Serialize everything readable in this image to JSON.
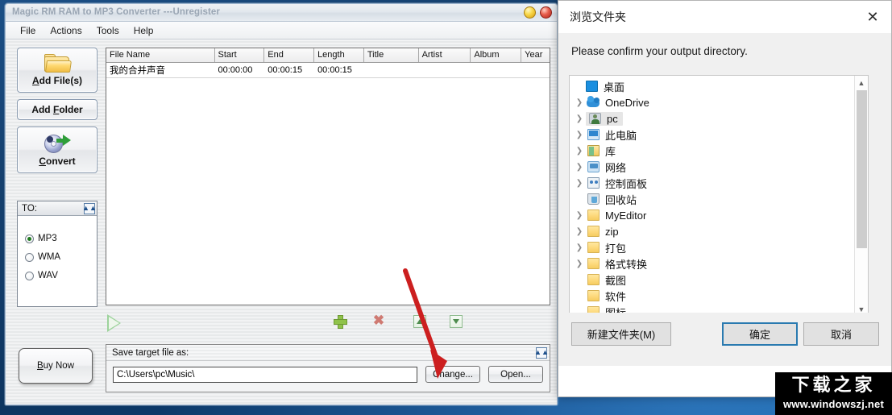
{
  "app": {
    "title": "Magic RM RAM to MP3 Converter ---Unregister",
    "window_buttons": [
      {
        "name": "minimize-button",
        "icon": "circle-yellow"
      },
      {
        "name": "close-button",
        "icon": "circle-red"
      }
    ],
    "menu": [
      "File",
      "Actions",
      "Tools",
      "Help"
    ],
    "buttons": {
      "add_files": "Add File(s)",
      "add_folder": "Add Folder",
      "convert": "Convert",
      "buy_now": "Buy Now"
    },
    "to_panel": {
      "title": "TO:",
      "collapse_icon": "chevron-up-icon",
      "options": [
        {
          "label": "MP3",
          "selected": true
        },
        {
          "label": "WMA",
          "selected": false
        },
        {
          "label": "WAV",
          "selected": false
        }
      ]
    },
    "file_list": {
      "columns": [
        "File Name",
        "Start",
        "End",
        "Length",
        "Title",
        "Artist",
        "Album",
        "Year"
      ],
      "rows": [
        {
          "file_name": "我的合并声音",
          "start": "00:00:00",
          "end": "00:00:15",
          "length": "00:00:15",
          "title": "",
          "artist": "",
          "album": "",
          "year": ""
        }
      ]
    },
    "list_toolbar": [
      {
        "name": "play-button",
        "icon": "play-triangle-icon"
      },
      {
        "name": "add-row-button",
        "icon": "green-plus-icon"
      },
      {
        "name": "remove-row-button",
        "icon": "red-x-icon"
      },
      {
        "name": "move-up-button",
        "icon": "arrow-up-icon"
      },
      {
        "name": "move-down-button",
        "icon": "arrow-down-icon"
      }
    ],
    "save_target": {
      "header": "Save target file as:",
      "collapse_icon": "chevron-up-icon",
      "path_value": "C:\\Users\\pc\\Music\\",
      "change_label": "Change...",
      "open_label": "Open..."
    }
  },
  "dialog": {
    "title": "浏览文件夹",
    "close_icon": "close-x-icon",
    "prompt": "Please confirm your output directory.",
    "tree": [
      {
        "label": "桌面",
        "icon": "desktop-icon",
        "indent": 0,
        "expander": "none",
        "selected": false
      },
      {
        "label": "OneDrive",
        "icon": "onedrive-cloud-icon",
        "indent": 1,
        "expander": "collapsed",
        "selected": false
      },
      {
        "label": "pc",
        "icon": "user-icon",
        "indent": 1,
        "expander": "collapsed",
        "selected": true
      },
      {
        "label": "此电脑",
        "icon": "this-pc-icon",
        "indent": 1,
        "expander": "collapsed",
        "selected": false
      },
      {
        "label": "库",
        "icon": "library-icon",
        "indent": 1,
        "expander": "collapsed",
        "selected": false
      },
      {
        "label": "网络",
        "icon": "network-icon",
        "indent": 1,
        "expander": "collapsed",
        "selected": false
      },
      {
        "label": "控制面板",
        "icon": "control-panel-icon",
        "indent": 1,
        "expander": "collapsed",
        "selected": false
      },
      {
        "label": "回收站",
        "icon": "recycle-bin-icon",
        "indent": 1,
        "expander": "none",
        "selected": false
      },
      {
        "label": "MyEditor",
        "icon": "folder-icon",
        "indent": 1,
        "expander": "collapsed",
        "selected": false
      },
      {
        "label": "zip",
        "icon": "folder-icon",
        "indent": 1,
        "expander": "collapsed",
        "selected": false
      },
      {
        "label": "打包",
        "icon": "folder-icon",
        "indent": 1,
        "expander": "collapsed",
        "selected": false
      },
      {
        "label": "格式转换",
        "icon": "folder-icon",
        "indent": 1,
        "expander": "collapsed",
        "selected": false
      },
      {
        "label": "截图",
        "icon": "folder-icon",
        "indent": 1,
        "expander": "none",
        "selected": false
      },
      {
        "label": "软件",
        "icon": "folder-icon",
        "indent": 1,
        "expander": "none",
        "selected": false
      },
      {
        "label": "图标",
        "icon": "folder-icon",
        "indent": 1,
        "expander": "none",
        "selected": false
      }
    ],
    "buttons": {
      "new_folder": "新建文件夹(M)",
      "ok": "确定",
      "cancel": "取消"
    }
  },
  "annotation": {
    "arrow_color": "#cc1f1f",
    "points_to": "Change... button"
  },
  "watermark": {
    "cn": "下载之家",
    "en": "www.windowszj.net"
  }
}
